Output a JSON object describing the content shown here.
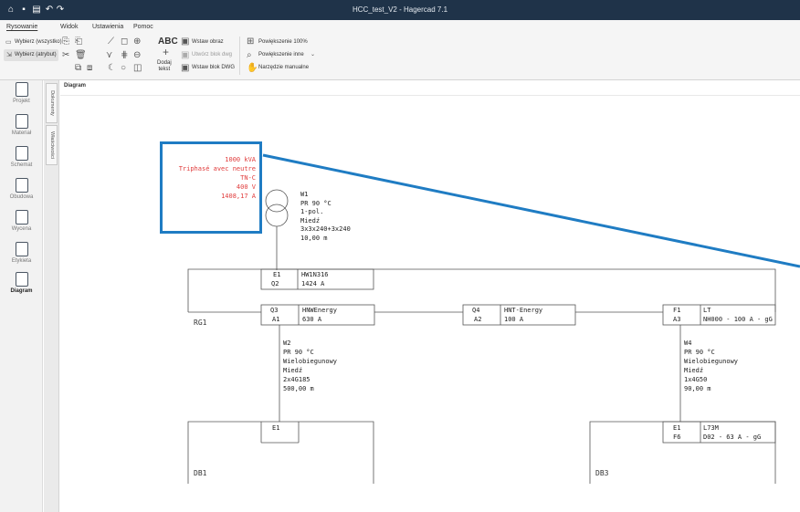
{
  "title_bar": {
    "title": "HCC_test_V2 - Hagercad 7.1"
  },
  "ribbon": {
    "tabs": [
      "Rysowanie",
      "Widok",
      "Ustawienia",
      "Pomoc"
    ],
    "select_all": "Wybierz (wszystko)",
    "select_attr": "Wybierz (atrybut)",
    "add_text": "ABC",
    "add_text_label": "Dodaj\ntekst",
    "insert_image": "Wstaw obraz",
    "create_dwg_block": "Utwórz blok dwg",
    "insert_dwg_block": "Wstaw blok DWG",
    "zoom_100": "Powiększenie 100%",
    "zoom_other": "Powiększenie inne",
    "manual_tool": "Narzędzie manualne"
  },
  "sidebar": {
    "items": [
      "Projekt",
      "Materiał",
      "Schemat",
      "Obudowa",
      "Wycena",
      "Etykieta",
      "Diagram"
    ],
    "active": "Diagram"
  },
  "vertical_tabs": [
    "Dokumenty",
    "Właściwości"
  ],
  "document": {
    "title": "Diagram"
  },
  "diagram": {
    "source": [
      "1000 kVA",
      "Triphasé avec neutre",
      "TN-C",
      "400 V",
      "1408,17 A"
    ],
    "cable_w1": [
      "W1",
      "PR 90 °C",
      "1-pol.",
      "Miedź",
      "3x3x240+3x240",
      "10,00 m"
    ],
    "main_breaker": {
      "ref1": "E1",
      "ref2": "Q2",
      "type": "HW1N316",
      "rating": "1424 A"
    },
    "rg1": {
      "label": "RG1"
    },
    "q3": {
      "ref1": "Q3",
      "ref2": "A1",
      "type": "HNWEnergy",
      "rating": "630 A"
    },
    "q4": {
      "ref1": "Q4",
      "ref2": "A2",
      "type": "HNT-Energy",
      "rating": "100 A"
    },
    "f1": {
      "ref1": "F1",
      "ref2": "A3",
      "type": "LT",
      "rating": "NH000 - 100 A - gG"
    },
    "cable_w2": [
      "W2",
      "PR 90 °C",
      "Wielobiegunowy",
      "Miedź",
      "2x4G185",
      "500,00 m"
    ],
    "cable_w4": [
      "W4",
      "PR 90 °C",
      "Wielobiegunowy",
      "Miedź",
      "1x4G50",
      "90,00 m"
    ],
    "db1": {
      "label": "DB1",
      "ref1": "E1"
    },
    "db3": {
      "label": "DB3",
      "ref1": "E1",
      "ref2": "F6",
      "type": "L73M",
      "rating": "D02 - 63 A - gG"
    }
  },
  "colors": {
    "title_bar": "#1f3349",
    "callout": "#1f7cc3",
    "source_text": "#e03c3c"
  }
}
